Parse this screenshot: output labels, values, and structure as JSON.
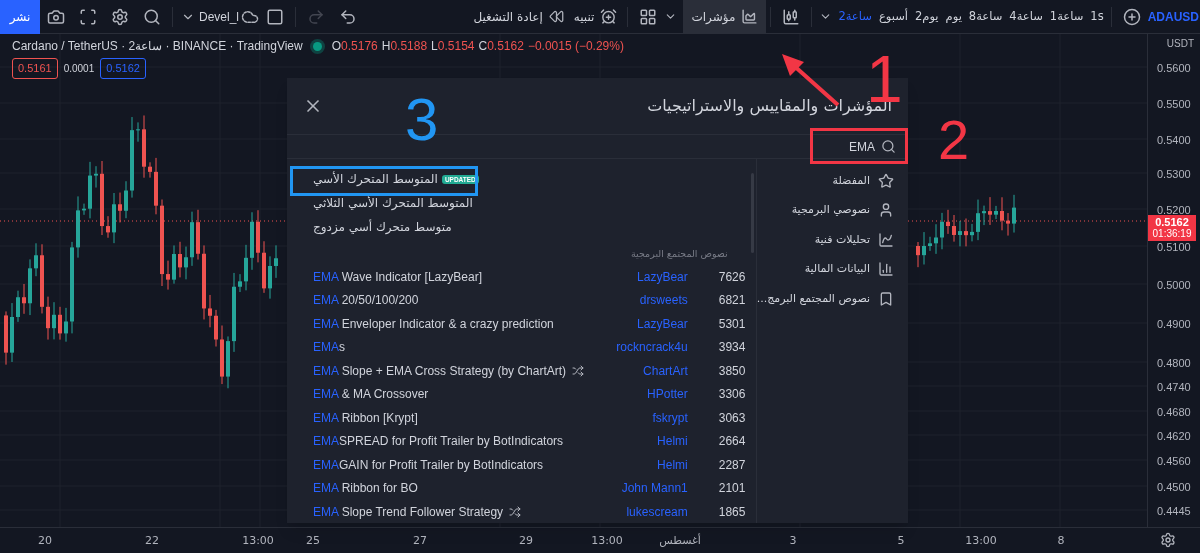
{
  "toolbar": {
    "publish": "نشر",
    "layout_name": "Devel_l",
    "replay": "إعادة التشغيل",
    "alert": "تنبيه",
    "indicators": "مؤشرات",
    "symbol": "ADAUSD",
    "intervals": [
      {
        "label": "1s",
        "selected": false
      },
      {
        "label": "1ساعة",
        "selected": false
      },
      {
        "label": "4ساعة",
        "selected": false
      },
      {
        "label": "8ساعة",
        "selected": false
      },
      {
        "label": "يوم",
        "selected": false
      },
      {
        "label": "2يوم",
        "selected": false
      },
      {
        "label": "أسبوع",
        "selected": false
      },
      {
        "label": "2ساعة",
        "selected": true
      }
    ]
  },
  "legend": {
    "title": "Cardano / TetherUS · 2ساعة · BINANCE · TradingView",
    "ohlc": [
      {
        "key": "O",
        "value": "0.5176"
      },
      {
        "key": "H",
        "value": "0.5188"
      },
      {
        "key": "L",
        "value": "0.5154"
      },
      {
        "key": "C",
        "value": "0.5162"
      }
    ],
    "change": "−0.0015 (−0.29%)",
    "sell": "0.5161",
    "spread": "0.0001",
    "buy": "0.5162"
  },
  "price_axis": {
    "currency": "USDT",
    "labels": [
      "0.5600",
      "0.5500",
      "0.5400",
      "0.5300",
      "0.5200",
      "0.5100",
      "0.5000",
      "0.4900",
      "0.4800",
      "0.4740",
      "0.4680",
      "0.4620",
      "0.4560",
      "0.4500",
      "0.4445"
    ],
    "last_price": "0.5162",
    "countdown": "01:36:19"
  },
  "time_axis": {
    "labels": [
      "20",
      "22",
      "13:00",
      "25",
      "27",
      "29",
      "13:00",
      "أغسطس",
      "3",
      "5",
      "13:00",
      "8"
    ]
  },
  "dialog": {
    "title": "المؤشرات والمقاييس والاستراتيجيات",
    "search": {
      "value": "EMA"
    },
    "categories": [
      {
        "label": "المفضلة",
        "kind": "star"
      },
      {
        "label": "نصوصي البرمجية",
        "kind": "user"
      },
      {
        "label": "تحليلات فنية",
        "kind": "chart"
      },
      {
        "label": "البيانات المالية",
        "kind": "bars"
      },
      {
        "label": "نصوص المجتمع البرمج...",
        "kind": "bookmark"
      }
    ],
    "builtins": [
      {
        "name": "المتوسط المتحرك الأسي",
        "badge": "UPDATED"
      },
      {
        "name": "المتوسط المتحرك الأسي الثلاثي"
      },
      {
        "name": "متوسط متحرك أسي مزدوج"
      }
    ],
    "section": "نصوص المجتمع البرمجية",
    "results": [
      {
        "match": "EMA",
        "rest": " Wave Indicator [LazyBear]",
        "author": "LazyBear",
        "count": "7626",
        "strategy": false
      },
      {
        "match": "EMA",
        "rest": " 20/50/100/200",
        "author": "drsweets",
        "count": "6821",
        "strategy": false
      },
      {
        "match": "EMA",
        "rest": " Enveloper Indicator & a crazy prediction",
        "author": "LazyBear",
        "count": "5301",
        "strategy": false
      },
      {
        "match": "EMA",
        "rest": "s",
        "author": "rockncrack4u",
        "count": "3934",
        "strategy": false
      },
      {
        "match": "EMA",
        "rest": " Slope + EMA Cross Strategy (by ChartArt)",
        "author": "ChartArt",
        "count": "3850",
        "strategy": true
      },
      {
        "match": "EMA",
        "rest": " & MA Crossover",
        "author": "HPotter",
        "count": "3306",
        "strategy": false
      },
      {
        "match": "EMA",
        "rest": " Ribbon [Krypt]",
        "author": "fskrypt",
        "count": "3063",
        "strategy": false
      },
      {
        "match": "EMA",
        "rest": "SPREAD for Profit Trailer by BotIndicators",
        "author": "Helmi",
        "count": "2664",
        "strategy": false
      },
      {
        "match": "EMA",
        "rest": "GAIN for Profit Trailer by BotIndicators",
        "author": "Helmi",
        "count": "2287",
        "strategy": false
      },
      {
        "match": "EMA",
        "rest": " Ribbon for BO",
        "author": "John Mann1",
        "count": "2101",
        "strategy": false
      },
      {
        "match": "EMA",
        "rest": " Slope Trend Follower Strategy",
        "author": "lukescream",
        "count": "1865",
        "strategy": true
      }
    ]
  },
  "annotations": [
    {
      "label": "1",
      "color": "#f23645"
    },
    {
      "label": "2",
      "color": "#f23645"
    },
    {
      "label": "3",
      "color": "#2196f3"
    }
  ]
}
